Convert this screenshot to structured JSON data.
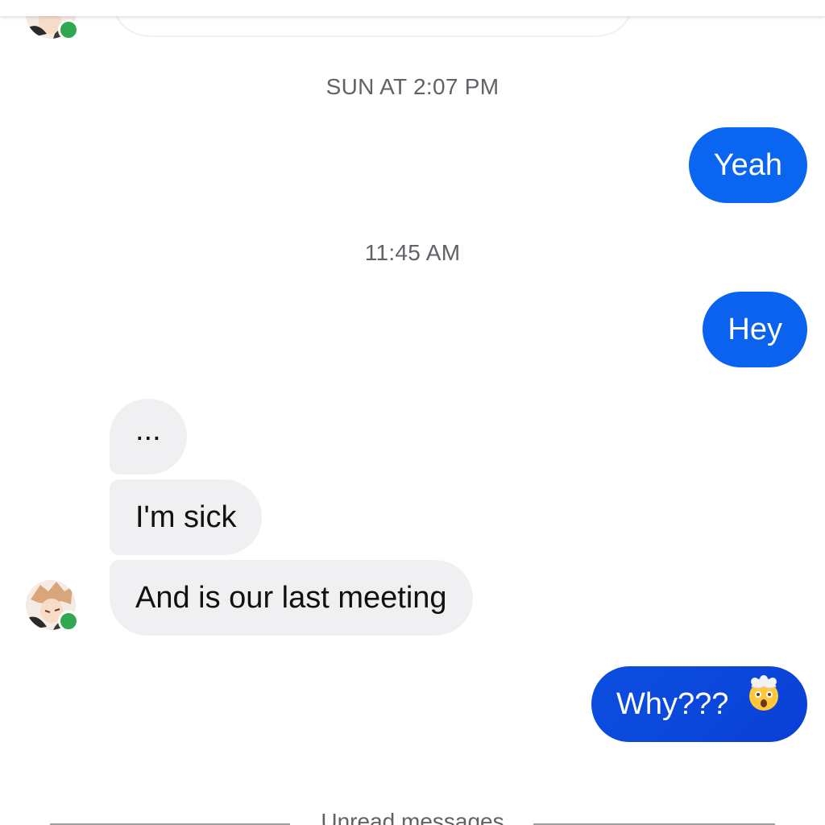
{
  "conversation": {
    "timestamps": [
      "SUN AT 2:07 PM",
      "11:45 AM"
    ],
    "outgoing": [
      {
        "text": "Yeah"
      },
      {
        "text": "Hey"
      },
      {
        "text": "Why???",
        "emoji": "exploding-head-emoji"
      }
    ],
    "incoming": [
      {
        "text": "..."
      },
      {
        "text": "I'm sick"
      },
      {
        "text": "And is our last meeting"
      }
    ],
    "unread_divider": "Unread messages"
  },
  "colors": {
    "outgoing_bubble": "#0a66f0",
    "outgoing_bubble_gradient_end": "#0b3fd6",
    "incoming_bubble": "#f0f0f3",
    "online_indicator": "#2fa84f",
    "timestamp_text": "#5f6368"
  },
  "contact": {
    "online": true
  }
}
